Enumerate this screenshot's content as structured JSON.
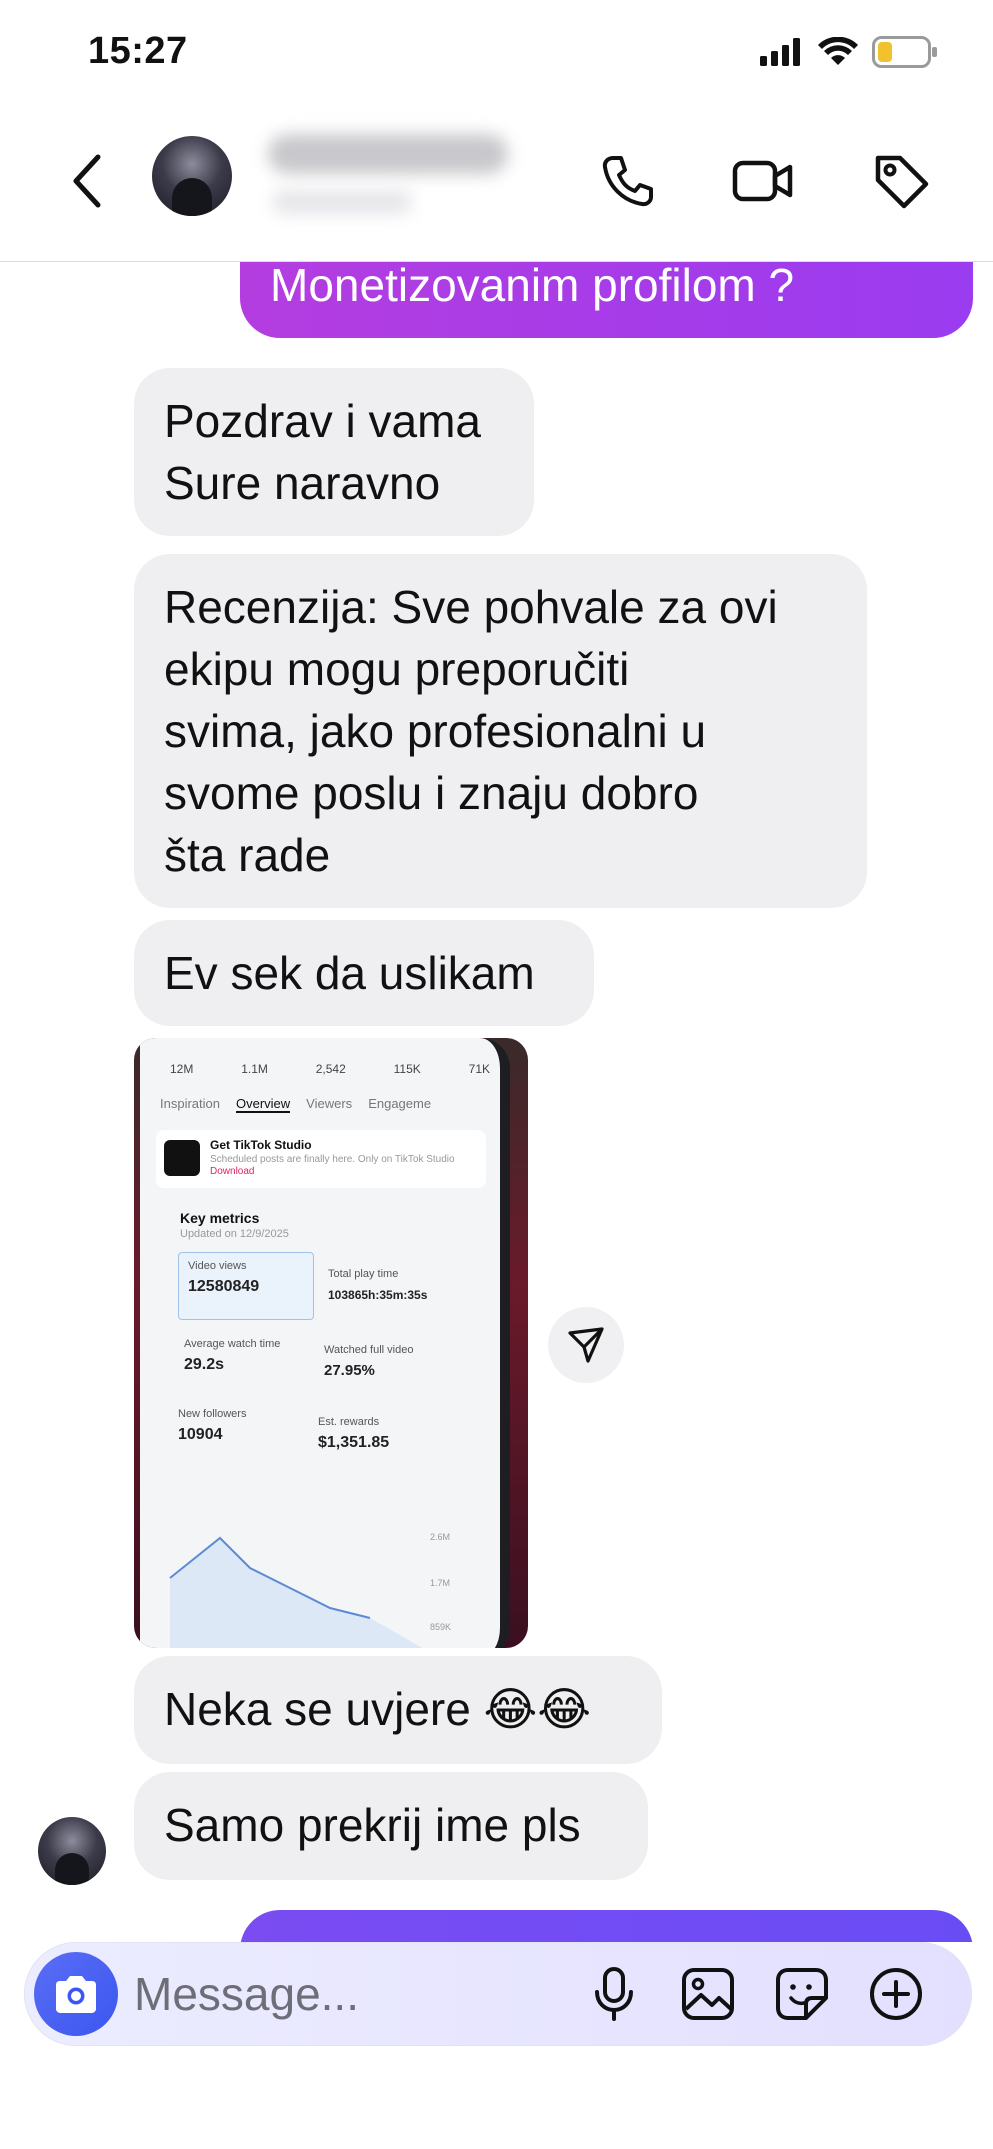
{
  "status_bar": {
    "time": "15:27"
  },
  "header": {
    "back_label": "Back",
    "contact_name_hidden": true
  },
  "messages": [
    {
      "direction": "outgoing",
      "text": "Monetizovanim profilom ?"
    },
    {
      "direction": "incoming",
      "lines": [
        "Pozdrav i vama",
        "Sure naravno"
      ]
    },
    {
      "direction": "incoming",
      "lines": [
        "Recenzija: Sve pohvale za ovi",
        "ekipu mogu preporučiti",
        "svima, jako profesionalni u",
        "svome poslu i znaju dobro",
        "šta rade"
      ]
    },
    {
      "direction": "incoming",
      "text": "Ev sek da uslikam"
    },
    {
      "direction": "incoming",
      "type": "image"
    },
    {
      "direction": "incoming",
      "text": "Neka se uvjere 😂😂"
    },
    {
      "direction": "incoming",
      "text": "Samo prekrij ime pls"
    }
  ],
  "screenshot_contents": {
    "stats": [
      "12M",
      "1.1M",
      "2,542",
      "115K",
      "71K"
    ],
    "tabs": [
      "Inspiration",
      "Overview",
      "Viewers",
      "Engageme"
    ],
    "promo_title": "Get TikTok Studio",
    "promo_text": "Scheduled posts are finally here. Only on TikTok Studio",
    "promo_link": "Download",
    "key_metrics_title": "Key metrics",
    "updated": "Updated on 12/9/2025",
    "metrics": [
      {
        "label": "Video views",
        "value": "12580849"
      },
      {
        "label": "Total play time",
        "value": "103865h:35m:35s"
      },
      {
        "label": "Average watch time",
        "value": "29.2s"
      },
      {
        "label": "Watched full video",
        "value": "27.95%"
      },
      {
        "label": "New followers",
        "value": "10904"
      },
      {
        "label": "Est. rewards",
        "value": "$1,351.85"
      }
    ],
    "chart_ticks": [
      "2.6M",
      "1.7M",
      "859K"
    ]
  },
  "composer": {
    "placeholder": "Message..."
  },
  "icons": {
    "status": [
      "signal-icon",
      "wifi-icon",
      "battery-icon"
    ],
    "header": [
      "back-chevron-icon",
      "phone-icon",
      "video-camera-icon",
      "tag-icon"
    ],
    "composer": [
      "camera-icon",
      "microphone-icon",
      "gallery-icon",
      "sticker-icon",
      "plus-circle-icon"
    ],
    "share": "send-icon"
  },
  "colors": {
    "outgoing_bubble": "#b43de0",
    "incoming_bubble": "#efeff1",
    "camera_button": "#3b57f0",
    "battery_level": "#f2c12e"
  }
}
